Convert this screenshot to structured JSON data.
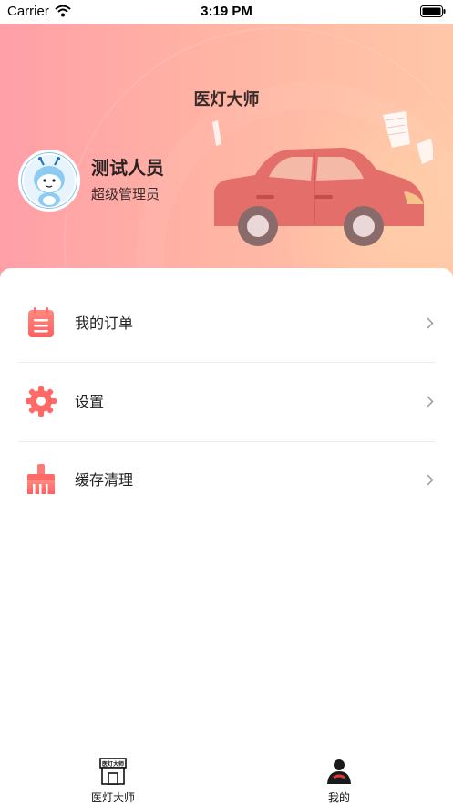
{
  "status_bar": {
    "carrier": "Carrier",
    "time": "3:19 PM",
    "wifi_icon": "wifi-icon",
    "battery_icon": "battery-icon"
  },
  "header": {
    "title": "医灯大师",
    "gradient_colors": [
      "#ff9fa8",
      "#ffc7a8"
    ]
  },
  "profile": {
    "name": "测试人员",
    "role": "超级管理员",
    "avatar_icon": "avatar-icon"
  },
  "menu": {
    "items": [
      {
        "label": "我的订单",
        "icon": "clipboard-icon"
      },
      {
        "label": "设置",
        "icon": "gear-icon"
      },
      {
        "label": "缓存清理",
        "icon": "brush-icon"
      }
    ],
    "icon_color": "#ff6f6f"
  },
  "tab_bar": {
    "tabs": [
      {
        "label": "医灯大师",
        "icon": "shop-icon",
        "icon_text": "医灯大师"
      },
      {
        "label": "我的",
        "icon": "user-icon"
      }
    ]
  }
}
